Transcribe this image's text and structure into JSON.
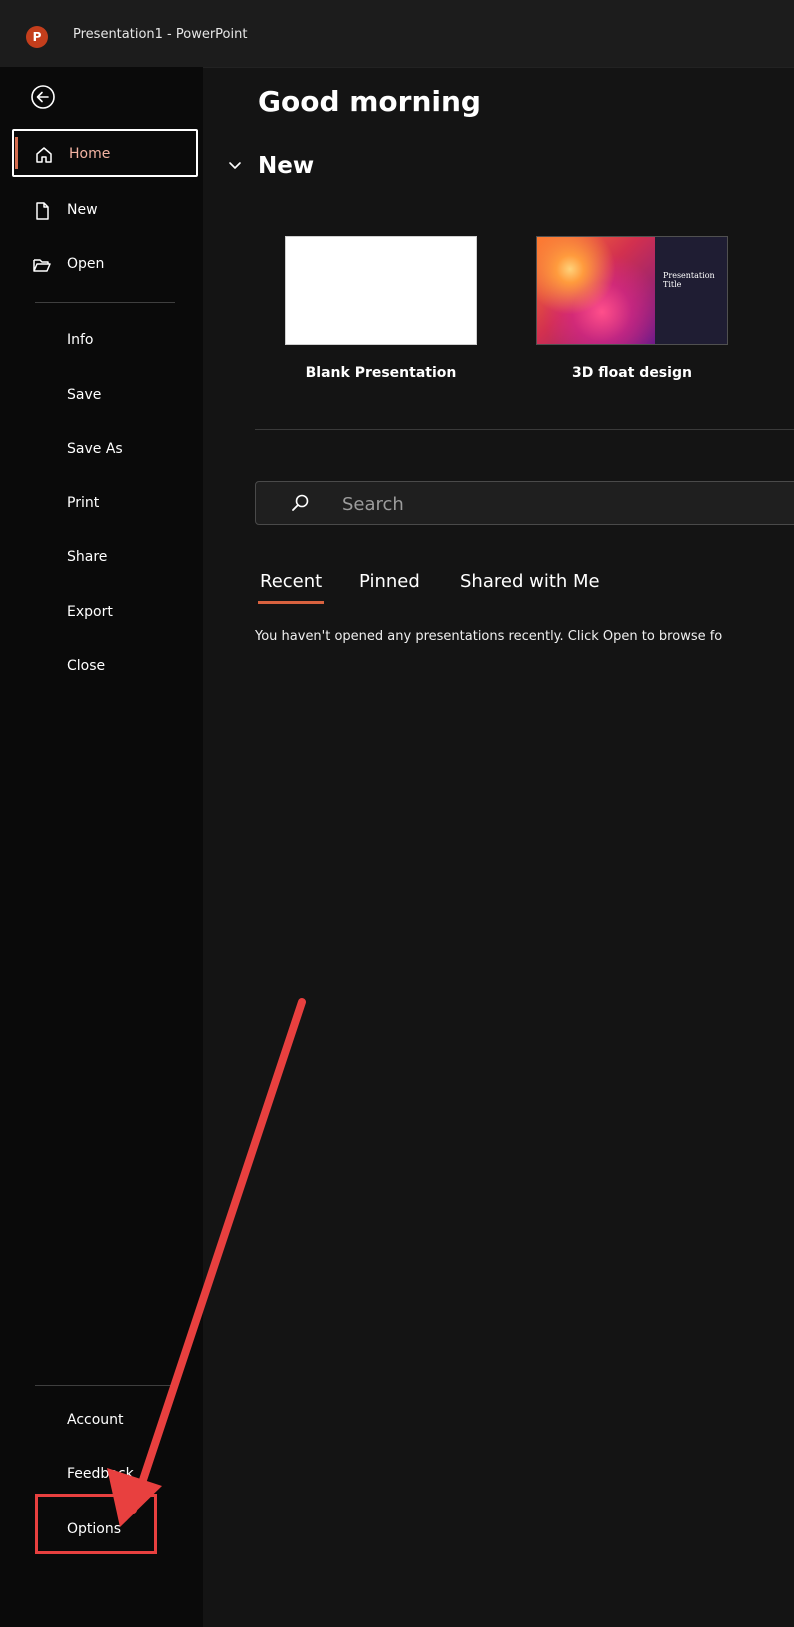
{
  "window": {
    "title": "Presentation1  -  PowerPoint",
    "app_logo_letter": "P"
  },
  "sidebar": {
    "top_items": [
      {
        "label": "Home",
        "icon": "home-icon",
        "selected": true
      },
      {
        "label": "New",
        "icon": "document-icon"
      },
      {
        "label": "Open",
        "icon": "folder-open-icon"
      }
    ],
    "middle_items": [
      {
        "label": "Info"
      },
      {
        "label": "Save"
      },
      {
        "label": "Save As"
      },
      {
        "label": "Print"
      },
      {
        "label": "Share"
      },
      {
        "label": "Export"
      },
      {
        "label": "Close"
      }
    ],
    "bottom_items": [
      {
        "label": "Account"
      },
      {
        "label": "Feedback"
      },
      {
        "label": "Options"
      }
    ]
  },
  "main": {
    "greeting": "Good morning",
    "new_section": {
      "heading": "New",
      "templates": [
        {
          "label": "Blank Presentation"
        },
        {
          "label": "3D float design",
          "thumbnail_title": "Presentation Title"
        }
      ]
    },
    "search": {
      "placeholder": "Search",
      "value": ""
    },
    "tabs": [
      {
        "label": "Recent",
        "active": true
      },
      {
        "label": "Pinned"
      },
      {
        "label": "Shared with Me"
      }
    ],
    "empty_message": "You haven't opened any presentations recently. Click Open to browse fo"
  },
  "colors": {
    "accent": "#d9623f",
    "annotation": "#e8403f",
    "sidebar_bg": "#0a0a0a",
    "main_bg": "#141414"
  }
}
